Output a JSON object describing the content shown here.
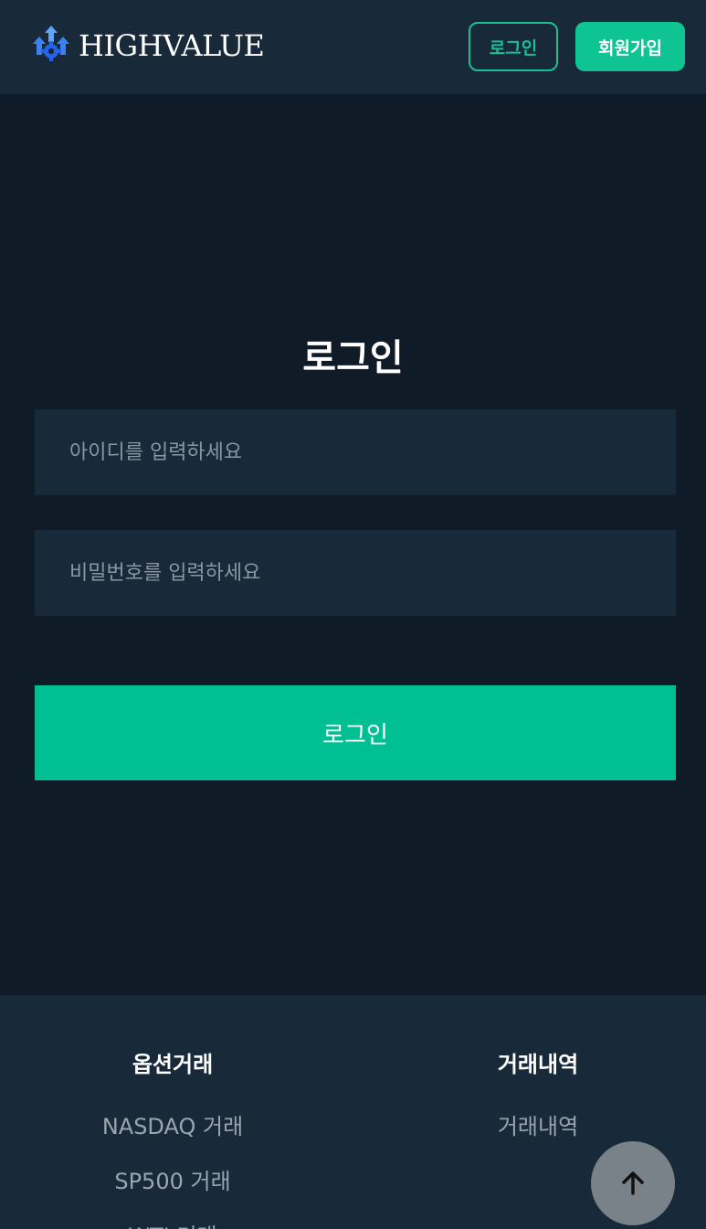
{
  "brand": {
    "name": "HIGHVALUE",
    "logo_icon": "gear-arrows-icon"
  },
  "header": {
    "login_label": "로그인",
    "signup_label": "회원가입"
  },
  "login_form": {
    "title": "로그인",
    "id_placeholder": "아이디를 입력하세요",
    "password_placeholder": "비밀번호를 입력하세요",
    "submit_label": "로그인"
  },
  "footer": {
    "columns": [
      {
        "heading": "옵션거래",
        "links": [
          "NASDAQ 거래",
          "SP500 거래",
          "WTI 거래"
        ]
      },
      {
        "heading": "거래내역",
        "links": [
          "거래내역"
        ]
      }
    ]
  },
  "scroll_top": {
    "icon": "arrow-up-icon"
  },
  "colors": {
    "header_bg": "#18293a",
    "page_bg": "#0f1b26",
    "accent": "#00c093",
    "input_bg": "#18293a"
  }
}
